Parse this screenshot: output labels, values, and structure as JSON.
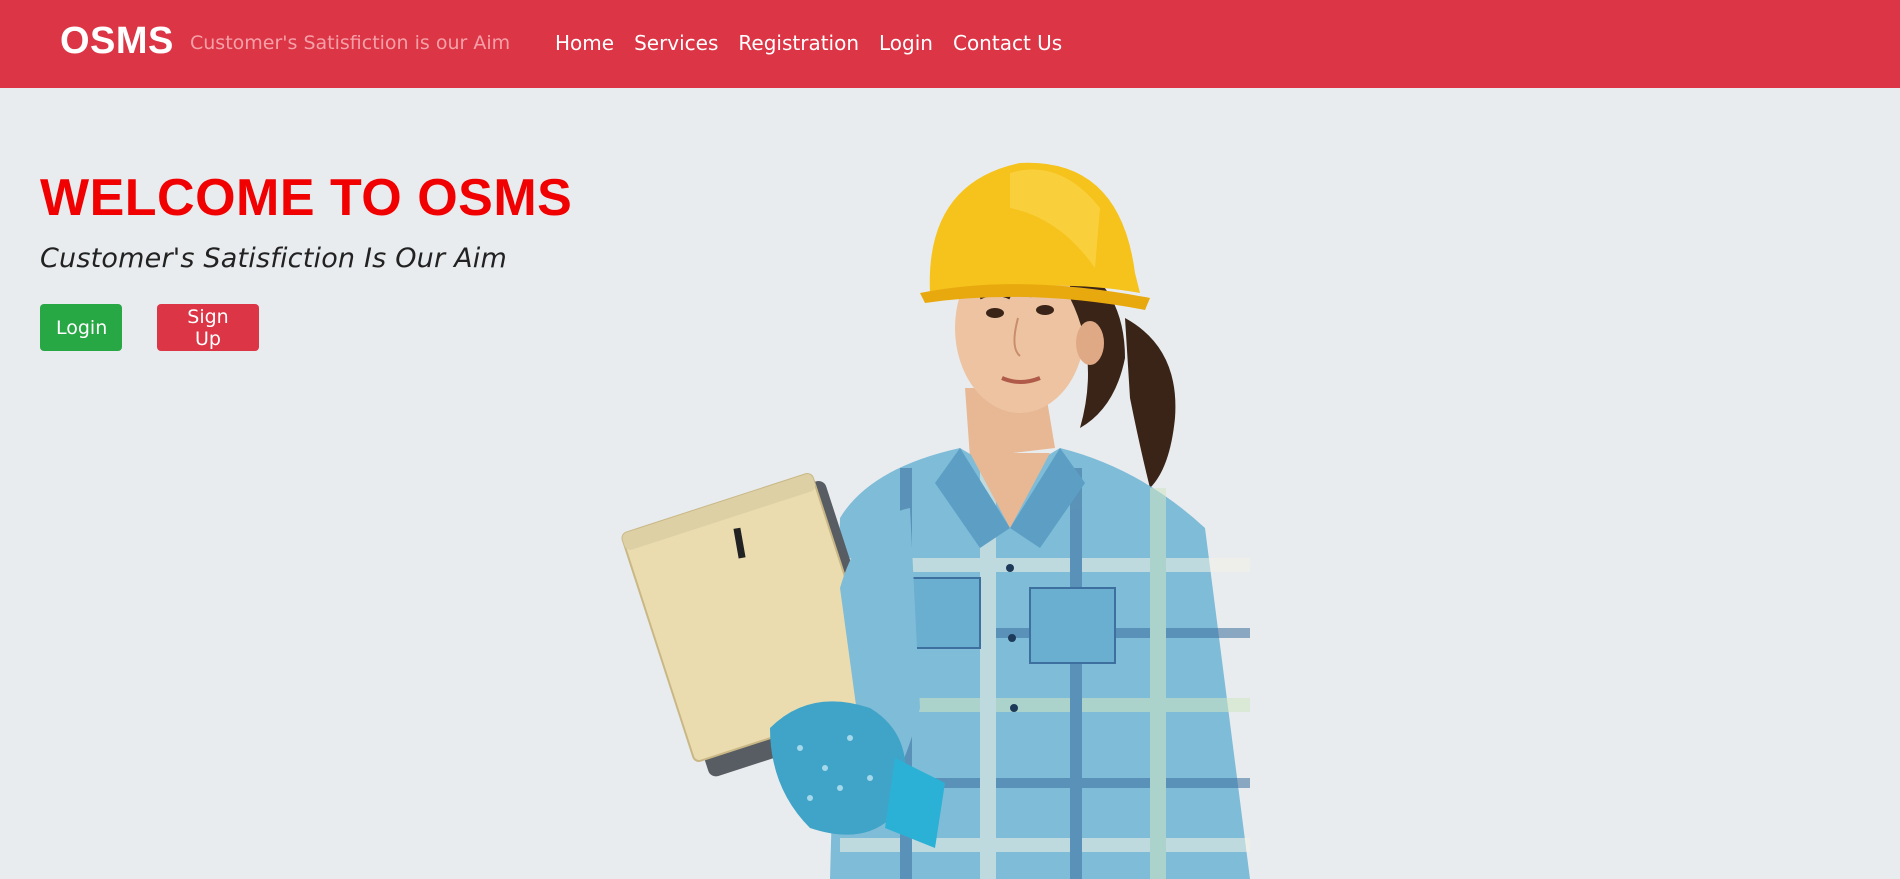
{
  "navbar": {
    "brand": "OSMS",
    "tagline": "Customer's Satisfiction is our Aim",
    "links": [
      "Home",
      "Services",
      "Registration",
      "Login",
      "Contact Us"
    ]
  },
  "hero": {
    "title": "WELCOME TO OSMS",
    "subtitle": "Customer's Satisfiction Is Our Aim",
    "login_label": "Login",
    "signup_label": "Sign Up"
  },
  "colors": {
    "navbar": "#dc3545",
    "background": "#e9ecef",
    "title": "#f00000",
    "login_button": "#28a745",
    "signup_button": "#dc3545"
  }
}
